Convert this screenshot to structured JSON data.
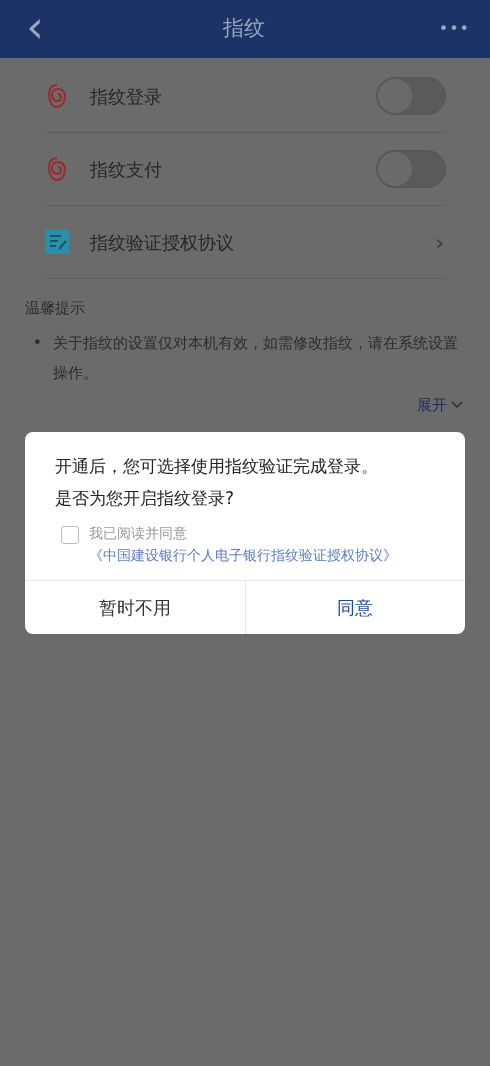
{
  "header": {
    "back": "‹",
    "title": "指纹",
    "more": "•••"
  },
  "settings": [
    {
      "kind": "toggle",
      "label": "指纹登录",
      "on": false
    },
    {
      "kind": "toggle",
      "label": "指纹支付",
      "on": false
    },
    {
      "kind": "link",
      "label": "指纹验证授权协议",
      "chevron": "›"
    }
  ],
  "tips": {
    "title": "温馨提示",
    "items": [
      {
        "bullet": "•",
        "text": "关于指纹的设置仅对本机有效，如需修改指纹，请在系统设置操作。"
      }
    ],
    "expand": "展开"
  },
  "dialog": {
    "lines": [
      "开通后，您可选择使用指纹验证完成登录。",
      "是否为您开启指纹登录?"
    ],
    "agreement": {
      "checked": false,
      "text": "我已阅读并同意",
      "link": "《中国建设银行个人电子银行指纹验证授权协议》"
    },
    "buttons": [
      {
        "label": "暂时不用",
        "primary": false
      },
      {
        "label": "同意",
        "primary": true
      }
    ]
  }
}
